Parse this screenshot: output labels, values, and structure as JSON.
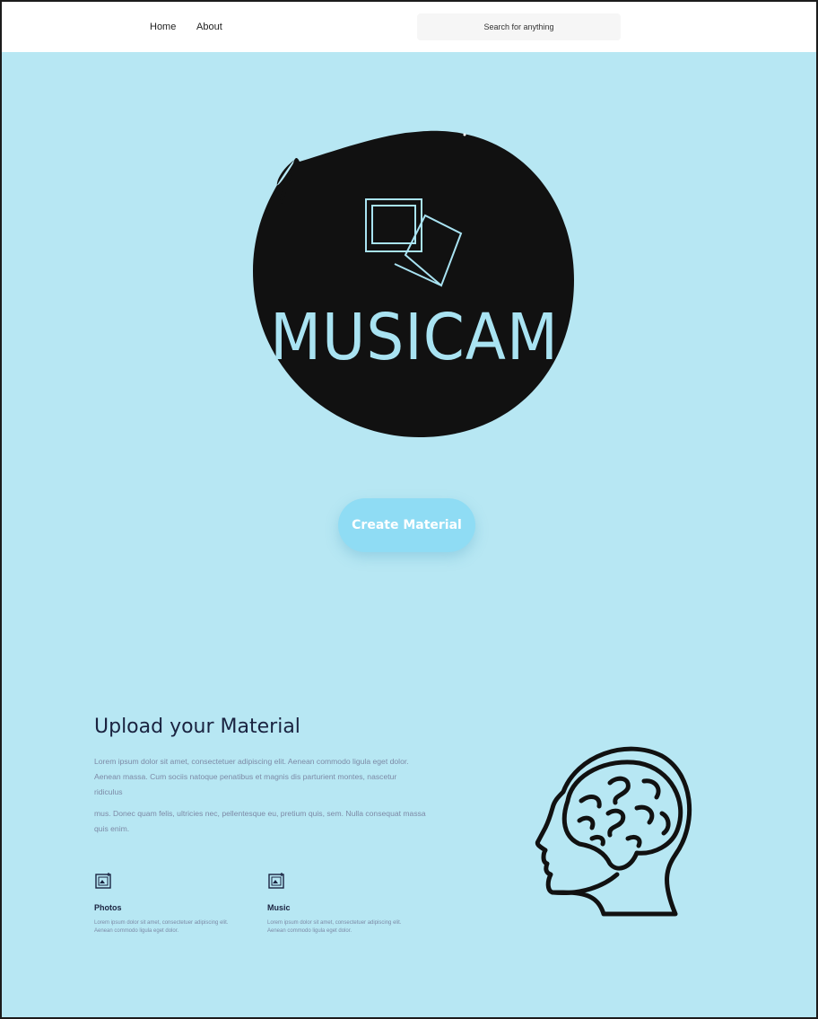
{
  "nav": {
    "home_label": "Home",
    "about_label": "About",
    "search_placeholder": "Search for anything"
  },
  "hero": {
    "logo_text": "MUSICAM",
    "cta_label": "Create Material"
  },
  "upload": {
    "title": "Upload your Material",
    "paragraph1": "Lorem ipsum dolor sit amet, consectetuer adipiscing elit. Aenean commodo ligula eget dolor. Aenean massa. Cum sociis natoque penatibus et magnis dis parturient montes, nascetur ridiculus",
    "paragraph2": "mus. Donec quam felis, ultricies nec, pellentesque eu, pretium quis, sem. Nulla consequat massa quis enim.",
    "features": [
      {
        "icon": "photo-icon",
        "title": "Photos",
        "desc": "Lorem ipsum dolor sit amet, consectetuer adipiscing elit. Aenean commodo ligula eget dolor."
      },
      {
        "icon": "music-icon",
        "title": "Music",
        "desc": "Lorem ipsum dolor sit amet, consectetuer adipiscing elit. Aenean commodo ligula eget dolor."
      }
    ]
  },
  "colors": {
    "background": "#b7e7f3",
    "logo_blob": "#111111",
    "logo_text": "#a9e3f2",
    "cta": "#8fdcf4",
    "heading": "#1a2340"
  }
}
